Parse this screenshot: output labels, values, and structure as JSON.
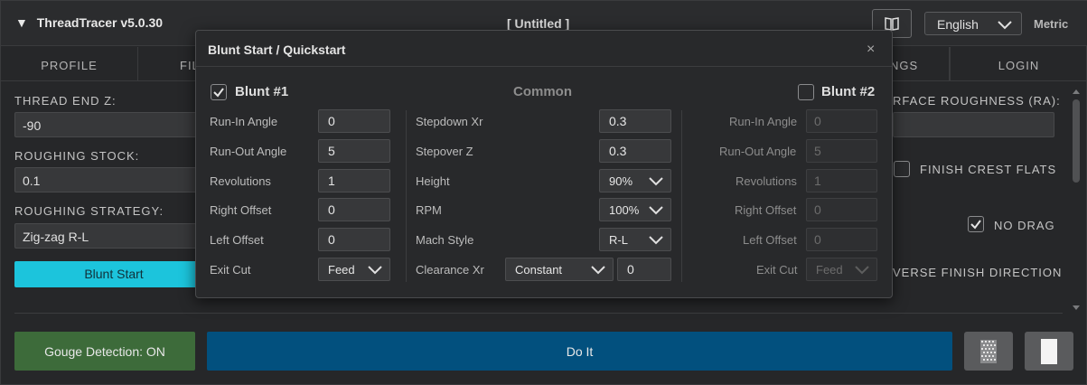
{
  "header": {
    "app_title": "ThreadTracer v5.0.30",
    "doc_title": "[ Untitled ]",
    "language": "English",
    "units": "Metric"
  },
  "tabs": [
    "PROFILE",
    "FIL",
    "NGS",
    "LOGIN"
  ],
  "left_panel": {
    "thread_end_z_label": "THREAD END Z:",
    "thread_end_z_value": "-90",
    "roughing_stock_label": "ROUGHING STOCK:",
    "roughing_stock_value": "0.1",
    "roughing_strategy_label": "ROUGHING STRATEGY:",
    "roughing_strategy_value": "Zig-zag R-L",
    "blunt_start_button": "Blunt Start"
  },
  "right_panel": {
    "surface_roughness_label": "RFACE ROUGHNESS (RA):",
    "finish_crest_flats_label": "FINISH CREST FLATS",
    "finish_crest_flats_checked": false,
    "no_drag_label": "NO DRAG",
    "no_drag_checked": true,
    "reverse_finish_label": "VERSE FINISH DIRECTION"
  },
  "bottom": {
    "gouge_button": "Gouge Detection: ON",
    "doit_button": "Do It"
  },
  "modal": {
    "title": "Blunt Start / Quickstart",
    "close": "×",
    "blunt1": {
      "label": "Blunt #1",
      "checked": true,
      "fields": [
        {
          "label": "Run-In Angle",
          "value": "0"
        },
        {
          "label": "Run-Out Angle",
          "value": "5"
        },
        {
          "label": "Revolutions",
          "value": "1"
        },
        {
          "label": "Right Offset",
          "value": "0"
        },
        {
          "label": "Left Offset",
          "value": "0"
        },
        {
          "label": "Exit Cut",
          "value": "Feed"
        }
      ]
    },
    "common": {
      "label": "Common",
      "fields": [
        {
          "label": "Stepdown Xr",
          "value": "0.3"
        },
        {
          "label": "Stepover Z",
          "value": "0.3"
        },
        {
          "label": "Height",
          "value": "90%"
        },
        {
          "label": "RPM",
          "value": "100%"
        },
        {
          "label": "Mach Style",
          "value": "R-L"
        },
        {
          "label": "Clearance Xr",
          "value": "Constant",
          "value2": "0"
        }
      ]
    },
    "blunt2": {
      "label": "Blunt #2",
      "checked": false,
      "fields": [
        {
          "label": "Run-In Angle",
          "value": "0"
        },
        {
          "label": "Run-Out Angle",
          "value": "5"
        },
        {
          "label": "Revolutions",
          "value": "1"
        },
        {
          "label": "Right Offset",
          "value": "0"
        },
        {
          "label": "Left Offset",
          "value": "0"
        },
        {
          "label": "Exit Cut",
          "value": "Feed"
        }
      ]
    }
  }
}
